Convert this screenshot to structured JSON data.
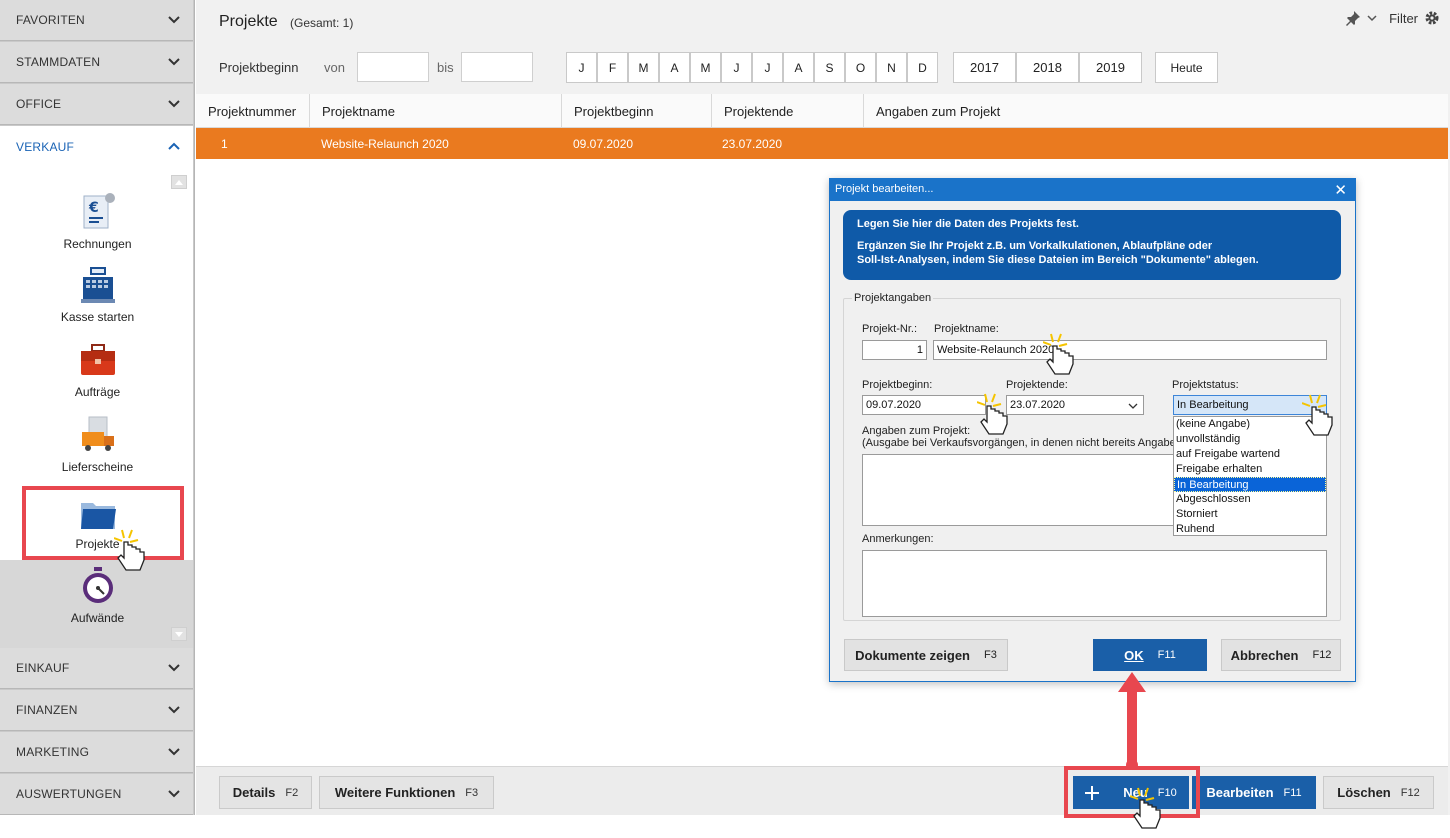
{
  "sidebar": {
    "sections_top": [
      "FAVORITEN",
      "STAMMDATEN",
      "OFFICE"
    ],
    "active_section": "VERKAUF",
    "items": [
      {
        "label": "Rechnungen",
        "icon": "invoice-euro-icon"
      },
      {
        "label": "Kasse starten",
        "icon": "cash-register-icon"
      },
      {
        "label": "Aufträge",
        "icon": "briefcase-icon"
      },
      {
        "label": "Lieferscheine",
        "icon": "delivery-truck-icon"
      },
      {
        "label": "Projekte",
        "icon": "folder-icon"
      },
      {
        "label": "Aufwände",
        "icon": "stopwatch-icon"
      }
    ],
    "sections_bottom": [
      "EINKAUF",
      "FINANZEN",
      "MARKETING",
      "AUSWERTUNGEN"
    ]
  },
  "header": {
    "title": "Projekte",
    "count": "(Gesamt: 1)",
    "filter_label": "Filter",
    "icons": [
      "pin-icon",
      "chevron-down-icon",
      "gear-icon"
    ]
  },
  "filter": {
    "label": "Projektbeginn",
    "von": "von",
    "bis": "bis",
    "von_value": "",
    "bis_value": "",
    "months": [
      "J",
      "F",
      "M",
      "A",
      "M",
      "J",
      "J",
      "A",
      "S",
      "O",
      "N",
      "D"
    ],
    "years": [
      "2017",
      "2018",
      "2019"
    ],
    "today": "Heute"
  },
  "table": {
    "columns": [
      "Projektnummer",
      "Projektname",
      "Projektbeginn",
      "Projektende",
      "Angaben zum Projekt"
    ],
    "rows": [
      {
        "nr": "1",
        "name": "Website-Relaunch 2020",
        "beginn": "09.07.2020",
        "ende": "23.07.2020",
        "angaben": ""
      }
    ],
    "selected_row_color": "#ea7a1f"
  },
  "bottom_bar": {
    "details": {
      "label": "Details",
      "key": "F2"
    },
    "weitere": {
      "label": "Weitere Funktionen",
      "key": "F3"
    },
    "neu": {
      "label": "Neu",
      "key": "F10",
      "icon": "plus-icon"
    },
    "bearbeiten": {
      "label": "Bearbeiten",
      "key": "F11"
    },
    "loeschen": {
      "label": "Löschen",
      "key": "F12"
    }
  },
  "dialog": {
    "title": "Projekt bearbeiten...",
    "info_line1": "Legen Sie hier die Daten des Projekts fest.",
    "info_line2": "Ergänzen Sie Ihr Projekt z.B. um Vorkalkulationen, Ablaufpläne oder",
    "info_line3": "Soll-Ist-Analysen, indem Sie diese Dateien im Bereich \"Dokumente\" ablegen.",
    "group_label": "Projektangaben",
    "nr_label": "Projekt-Nr.:",
    "nr_value": "1",
    "name_label": "Projektname:",
    "name_value": "Website-Relaunch 2020",
    "beginn_label": "Projektbeginn:",
    "beginn_value": "09.07.2020",
    "ende_label": "Projektende:",
    "ende_value": "23.07.2020",
    "status_label": "Projektstatus:",
    "status_value": "In Bearbeitung",
    "status_options": [
      "(keine Angabe)",
      "unvollständig",
      "auf Freigabe wartend",
      "Freigabe erhalten",
      "In Bearbeitung",
      "Abgeschlossen",
      "Storniert",
      "Ruhend"
    ],
    "status_selected_index": 4,
    "angaben_label": "Angaben zum Projekt:",
    "angaben_hint": "(Ausgabe bei Verkaufsvorgängen, in denen nicht bereits Angabe",
    "angaben_value": "",
    "anmerkungen_label": "Anmerkungen:",
    "anmerkungen_value": "",
    "btn_dokumente": {
      "label": "Dokumente zeigen",
      "key": "F3"
    },
    "btn_ok": {
      "label": "OK",
      "key": "F11"
    },
    "btn_abbrechen": {
      "label": "Abbrechen",
      "key": "F12"
    }
  },
  "colors": {
    "accent_blue": "#1a5fa8",
    "selection_orange": "#ea7a1f",
    "annotation_red": "#e8474f"
  }
}
